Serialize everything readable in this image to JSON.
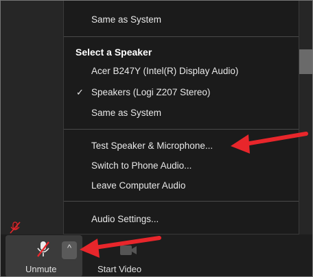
{
  "menu": {
    "top_item": "Same as System",
    "speaker_section": {
      "heading": "Select a Speaker",
      "items": [
        {
          "label": "Acer B247Y (Intel(R) Display Audio)",
          "checked": false
        },
        {
          "label": "Speakers (Logi Z207 Stereo)",
          "checked": true
        },
        {
          "label": "Same as System",
          "checked": false
        }
      ]
    },
    "check_glyph": "✓",
    "actions": [
      "Test Speaker & Microphone...",
      "Switch to Phone Audio...",
      "Leave Computer Audio"
    ],
    "settings": "Audio Settings..."
  },
  "toolbar": {
    "unmute_label": "Unmute",
    "caret_glyph": "^",
    "start_video_label": "Start Video",
    "mic_icon": "microphone-muted-icon",
    "video_icon": "video-camera-icon"
  },
  "colors": {
    "annotation_arrow": "#e8262b",
    "mute_slash": "#e8262b",
    "menu_bg": "#1b1b1b"
  }
}
